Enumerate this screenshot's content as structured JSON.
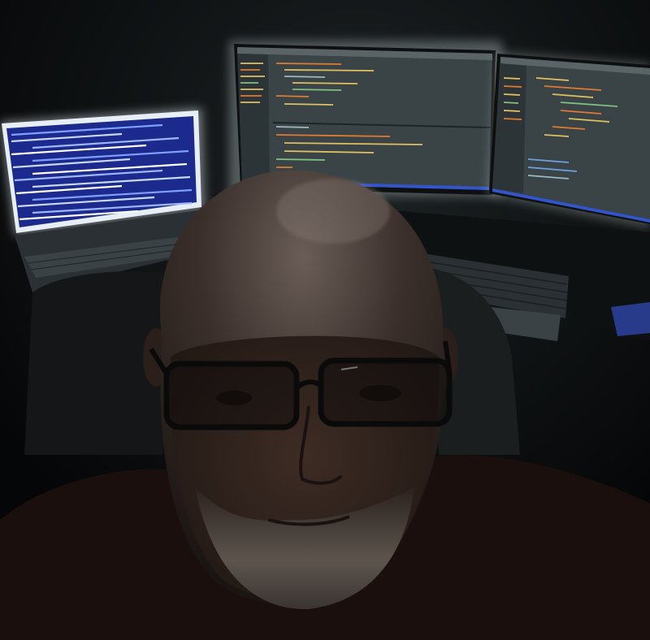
{
  "scene": {
    "subject": "selfie-at-desk",
    "palette": {
      "room": "#07090a",
      "screen_glow": "#c8d4d4",
      "laptop_screen": "#1b2a8c",
      "editor_bg": "#3a4447",
      "code_yellow": "#e0c060",
      "code_orange": "#e07a30",
      "code_green": "#80c080",
      "code_blue": "#6fa0e0",
      "skin": "#3a2a22",
      "beard": "#5a534c",
      "shirt": "#1a0f0d",
      "chair": "#141617",
      "accent_blue": "#3355cc"
    },
    "icons": [
      "laptop-icon",
      "monitor-icon",
      "keyboard-icon",
      "glasses-icon",
      "chair-icon"
    ]
  }
}
